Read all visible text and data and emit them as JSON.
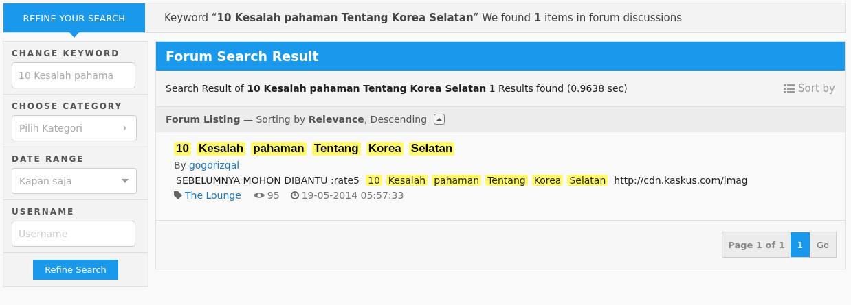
{
  "refine_tab": {
    "label": "REFINE YOUR SEARCH"
  },
  "summary": {
    "prefix": "Keyword “**10 Kesalah pahaman Tentang Korea Selatan**” We found **1** items in forum discussions"
  },
  "sidebar": {
    "sections": [
      {
        "kind": "text",
        "label": "CHANGE KEYWORD",
        "value": "10 Kesalah pahama"
      },
      {
        "kind": "picker",
        "label": "CHOOSE CATEGORY",
        "placeholder": "Pilih Kategori"
      },
      {
        "kind": "dropdown",
        "label": "DATE RANGE",
        "placeholder": "Kapan saja"
      },
      {
        "kind": "text",
        "label": "USERNAME",
        "placeholder": "Username"
      }
    ],
    "button": "Refine Search"
  },
  "panel": {
    "title": "Forum Search Result",
    "result_info": "Search Result of **10 Kesalah pahaman Tentang Korea Selatan** 1 Results found (0.9638 sec)",
    "sort_label": "Sort by",
    "listing_info": "**Forum Listing** — Sorting by **Relevance**, Descending",
    "results": [
      {
        "title_words": [
          "10",
          "Kesalah",
          "pahaman",
          "Tentang",
          "Korea",
          "Selatan"
        ],
        "by": "By",
        "author": "gogorizqal",
        "snippet": [
          {
            "text": "SEBELUMNYA MOHON DIBANTU :rate5",
            "highlight": false
          },
          {
            "text": "10",
            "highlight": true
          },
          {
            "text": "Kesalah",
            "highlight": true
          },
          {
            "text": "pahaman",
            "highlight": true
          },
          {
            "text": "Tentang",
            "highlight": true
          },
          {
            "text": "Korea",
            "highlight": true
          },
          {
            "text": "Selatan",
            "highlight": true
          },
          {
            "text": "http://cdn.kaskus.com/imag",
            "highlight": false
          }
        ],
        "forum": "The Lounge",
        "views": "95",
        "date": "19-05-2014 05:57:33"
      }
    ],
    "pagination": {
      "label": "Page 1 of 1",
      "pages": [
        {
          "label": "1",
          "selected": true
        }
      ],
      "go": "Go"
    }
  }
}
